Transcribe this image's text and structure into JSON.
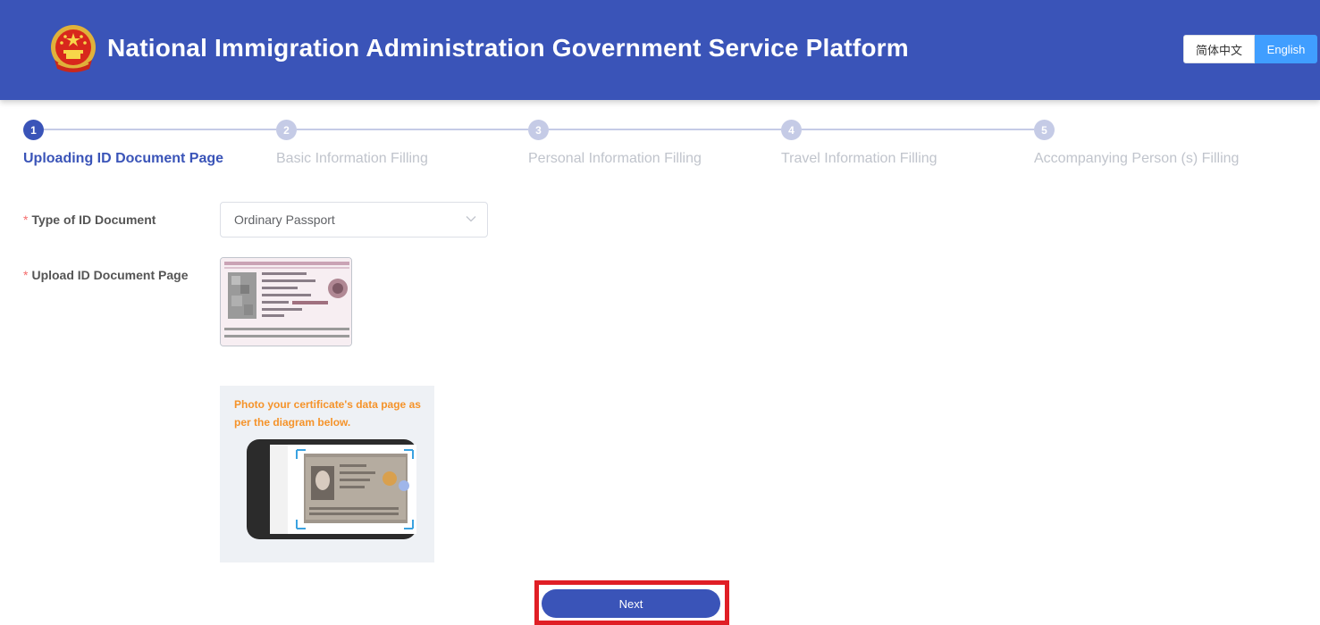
{
  "header": {
    "title": "National Immigration Administration Government Service Platform",
    "emblem_icon": "national-emblem-icon",
    "lang_zh": "简体中文",
    "lang_en": "English",
    "active_lang": "English",
    "bg_color": "#3a54b8"
  },
  "steps": {
    "items": [
      {
        "number": "1",
        "label": "Uploading ID Document Page",
        "active": true
      },
      {
        "number": "2",
        "label": "Basic Information Filling",
        "active": false
      },
      {
        "number": "3",
        "label": "Personal Information Filling",
        "active": false
      },
      {
        "number": "4",
        "label": "Travel Information Filling",
        "active": false
      },
      {
        "number": "5",
        "label": "Accompanying Person (s) Filling",
        "active": false
      }
    ],
    "active_color": "#3a54b8",
    "inactive_color": "#c5cbe6"
  },
  "form": {
    "required_mark": "*",
    "id_type_label": "Type of ID Document",
    "id_type_value": "Ordinary Passport",
    "upload_label": "Upload ID Document Page",
    "hint_text": "Photo your certificate's data page as per the diagram below."
  },
  "actions": {
    "next_label": "Next",
    "highlight_color": "#e01e25"
  }
}
